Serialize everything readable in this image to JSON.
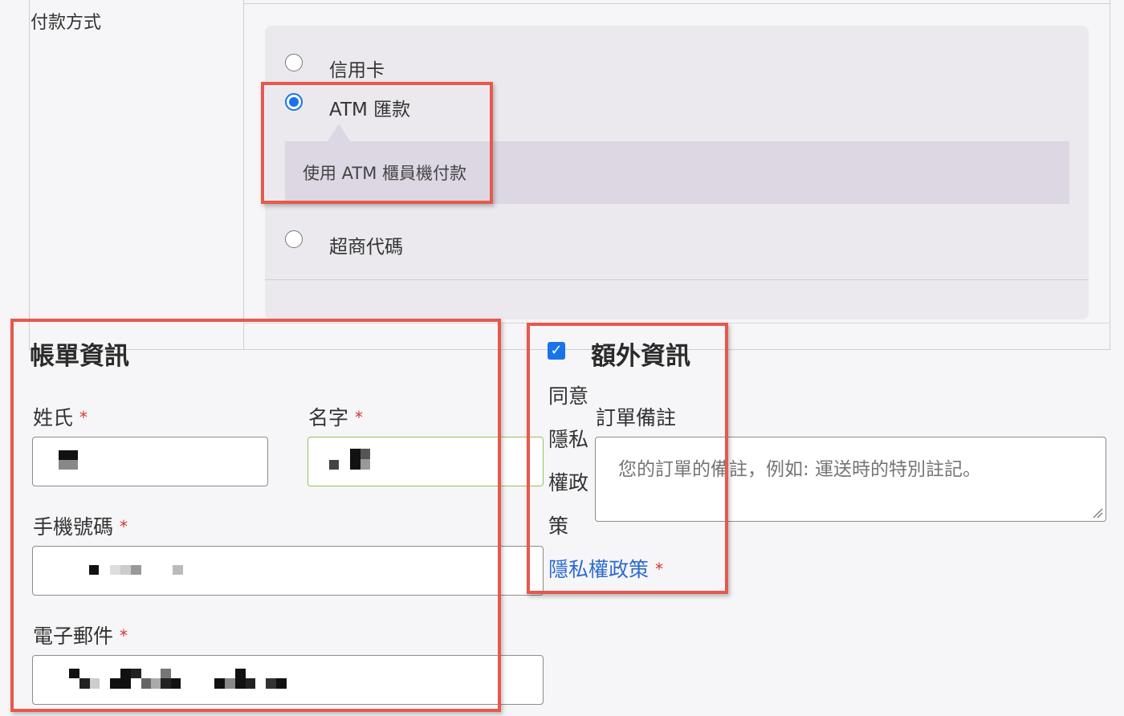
{
  "payment": {
    "label": "付款方式",
    "methods": [
      {
        "label": "信用卡",
        "selected": false
      },
      {
        "label": "ATM 匯款",
        "selected": true,
        "description": "使用 ATM 櫃員機付款"
      },
      {
        "label": "超商代碼",
        "selected": false
      }
    ]
  },
  "billing": {
    "title": "帳單資訊",
    "required_mark": "*",
    "fields": {
      "last_name": {
        "label": "姓氏"
      },
      "first_name": {
        "label": "名字"
      },
      "phone": {
        "label": "手機號碼"
      },
      "email": {
        "label": "電子郵件"
      }
    }
  },
  "additional": {
    "title": "額外資訊",
    "checked": true,
    "consent_lines": [
      "同意",
      "隱私",
      "權政",
      "策"
    ],
    "privacy_link": "隱私權政策",
    "required_mark": "*",
    "order_notes": {
      "label": "訂單備註",
      "placeholder": "您的訂單的備註，例如: 運送時的特別註記。"
    }
  },
  "colors": {
    "accent": "#1a73e8",
    "link": "#2d6bd0",
    "required": "#dd3333",
    "highlight": "#e7584c",
    "active_border": "#8fc35a"
  }
}
